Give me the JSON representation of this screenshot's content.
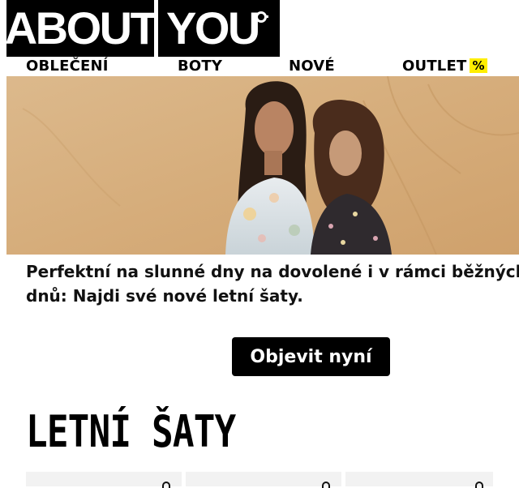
{
  "brand": {
    "logo_left": "ABOUT",
    "logo_right": "YOU"
  },
  "nav": {
    "items": [
      {
        "label": "OBLEČENÍ"
      },
      {
        "label": "BOTY"
      },
      {
        "label": "NOVÉ"
      },
      {
        "label": "OUTLET",
        "badge": "%"
      }
    ]
  },
  "hero": {
    "text": "Perfektní na slunné dny na dovolené i v rámci běžných dnů: Najdi své nové letní šaty.",
    "text_line1": "Perfektní na slunné dny na dovolené i v rámci běžných",
    "text_line2": "dnů: Najdi své nové letní šaty.",
    "cta_label": "Objevit nyní"
  },
  "section": {
    "title": "LETNÍ ŠATY"
  },
  "colors": {
    "accent": "#ffee00",
    "primary": "#000000"
  }
}
